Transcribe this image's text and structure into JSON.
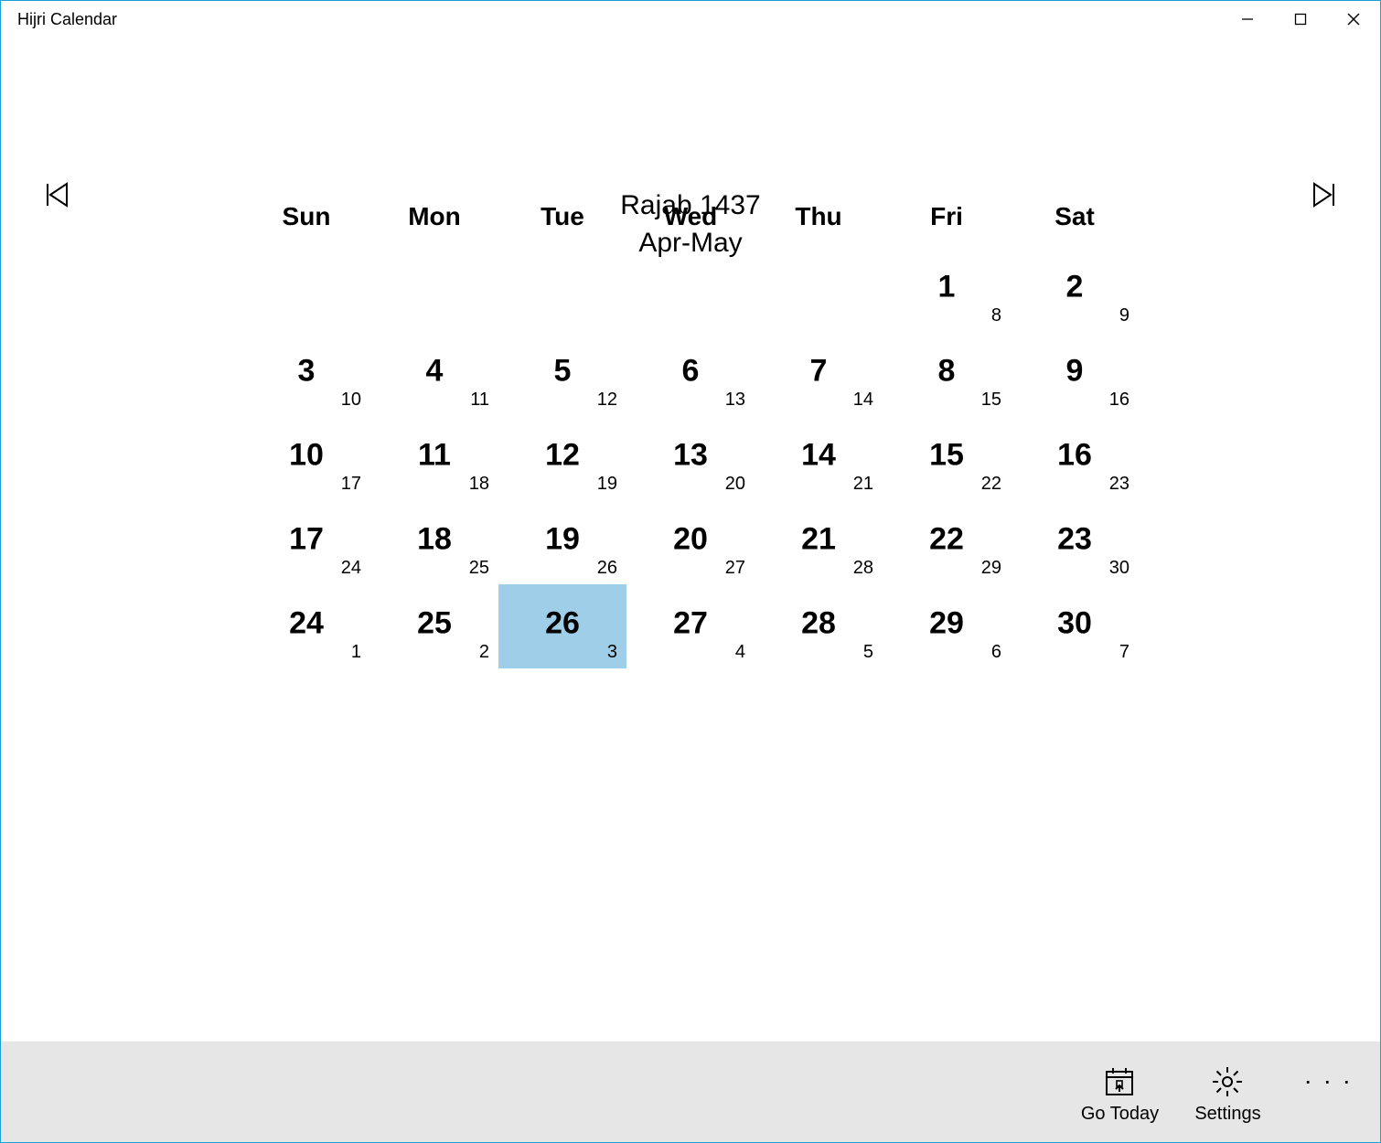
{
  "window": {
    "title": "Hijri Calendar"
  },
  "header": {
    "hijri_month": "Rajab 1437",
    "gregorian_span": "Apr-May"
  },
  "weekdays": [
    "Sun",
    "Mon",
    "Tue",
    "Wed",
    "Thu",
    "Fri",
    "Sat"
  ],
  "today_hijri": 26,
  "cells": [
    {
      "hijri": null,
      "greg": null
    },
    {
      "hijri": null,
      "greg": null
    },
    {
      "hijri": null,
      "greg": null
    },
    {
      "hijri": null,
      "greg": null
    },
    {
      "hijri": null,
      "greg": null
    },
    {
      "hijri": 1,
      "greg": 8
    },
    {
      "hijri": 2,
      "greg": 9
    },
    {
      "hijri": 3,
      "greg": 10
    },
    {
      "hijri": 4,
      "greg": 11
    },
    {
      "hijri": 5,
      "greg": 12
    },
    {
      "hijri": 6,
      "greg": 13
    },
    {
      "hijri": 7,
      "greg": 14
    },
    {
      "hijri": 8,
      "greg": 15
    },
    {
      "hijri": 9,
      "greg": 16
    },
    {
      "hijri": 10,
      "greg": 17
    },
    {
      "hijri": 11,
      "greg": 18
    },
    {
      "hijri": 12,
      "greg": 19
    },
    {
      "hijri": 13,
      "greg": 20
    },
    {
      "hijri": 14,
      "greg": 21
    },
    {
      "hijri": 15,
      "greg": 22
    },
    {
      "hijri": 16,
      "greg": 23
    },
    {
      "hijri": 17,
      "greg": 24
    },
    {
      "hijri": 18,
      "greg": 25
    },
    {
      "hijri": 19,
      "greg": 26
    },
    {
      "hijri": 20,
      "greg": 27
    },
    {
      "hijri": 21,
      "greg": 28
    },
    {
      "hijri": 22,
      "greg": 29
    },
    {
      "hijri": 23,
      "greg": 30
    },
    {
      "hijri": 24,
      "greg": 1
    },
    {
      "hijri": 25,
      "greg": 2
    },
    {
      "hijri": 26,
      "greg": 3
    },
    {
      "hijri": 27,
      "greg": 4
    },
    {
      "hijri": 28,
      "greg": 5
    },
    {
      "hijri": 29,
      "greg": 6
    },
    {
      "hijri": 30,
      "greg": 7
    }
  ],
  "commands": {
    "go_today": "Go Today",
    "settings": "Settings"
  }
}
